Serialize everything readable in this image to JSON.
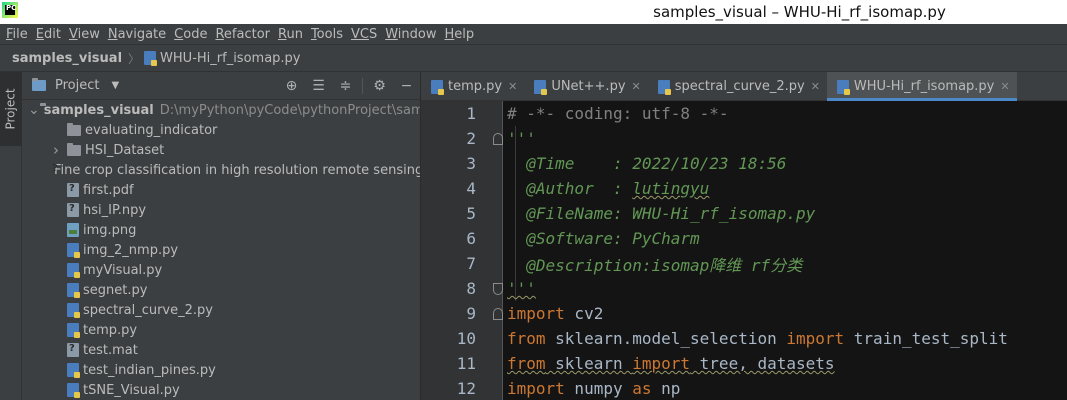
{
  "window": {
    "title": "samples_visual – WHU-Hi_rf_isomap.py",
    "logo_text": "PC"
  },
  "menu": [
    {
      "mnemonic": "F",
      "rest": "ile"
    },
    {
      "mnemonic": "E",
      "rest": "dit"
    },
    {
      "mnemonic": "V",
      "rest": "iew"
    },
    {
      "mnemonic": "N",
      "rest": "avigate"
    },
    {
      "mnemonic": "C",
      "rest": "ode"
    },
    {
      "mnemonic": "R",
      "rest": "efactor"
    },
    {
      "mnemonic": "R",
      "rest": "un"
    },
    {
      "mnemonic": "T",
      "rest": "ools"
    },
    {
      "mnemonic": "VC",
      "rest": "S"
    },
    {
      "mnemonic": "W",
      "rest": "indow"
    },
    {
      "mnemonic": "H",
      "rest": "elp"
    }
  ],
  "breadcrumb": {
    "project": "samples_visual",
    "file": "WHU-Hi_rf_isomap.py"
  },
  "left_strip": {
    "tab_label": "Project"
  },
  "project_panel": {
    "title": "Project",
    "tools": [
      "target-icon",
      "expand-all-icon",
      "collapse-all-icon",
      "gear-icon",
      "hide-icon"
    ],
    "tree": [
      {
        "label": "samples_visual",
        "path": "D:\\myPython\\pyCode\\pythonProject\\samples",
        "type": "root",
        "expanded": true
      },
      {
        "label": "evaluating_indicator",
        "type": "folder"
      },
      {
        "label": "HSI_Dataset",
        "type": "folder",
        "collapsed": true
      },
      {
        "label": "Fine crop classification in high resolution remote sensing b",
        "type": "unknown"
      },
      {
        "label": "first.pdf",
        "type": "unknown"
      },
      {
        "label": "hsi_IP.npy",
        "type": "unknown"
      },
      {
        "label": "img.png",
        "type": "image"
      },
      {
        "label": "img_2_nmp.py",
        "type": "py"
      },
      {
        "label": "myVisual.py",
        "type": "py"
      },
      {
        "label": "segnet.py",
        "type": "py"
      },
      {
        "label": "spectral_curve_2.py",
        "type": "py"
      },
      {
        "label": "temp.py",
        "type": "py"
      },
      {
        "label": "test.mat",
        "type": "unknown"
      },
      {
        "label": "test_indian_pines.py",
        "type": "py"
      },
      {
        "label": "tSNE_Visual.py",
        "type": "py"
      }
    ]
  },
  "tabs": [
    {
      "label": "temp.py",
      "active": false
    },
    {
      "label": "UNet++.py",
      "active": false
    },
    {
      "label": "spectral_curve_2.py",
      "active": false
    },
    {
      "label": "WHU-Hi_rf_isomap.py",
      "active": true
    }
  ],
  "code": {
    "line_numbers": [
      "1",
      "2",
      "3",
      "4",
      "5",
      "6",
      "7",
      "8",
      "9",
      "10",
      "11",
      "12"
    ],
    "l1": "# -*- coding: utf-8 -*-",
    "l2": "'''",
    "l3": "  @Time    : 2022/10/23 18:56",
    "l4_a": "  @Author  : ",
    "l4_b": "lutingyu",
    "l5_a": "  @FileName: ",
    "l5_b": "WHU-Hi_rf_isomap.py",
    "l6": "  @Software: PyCharm",
    "l7": "  @Description:isomap降维 rf分类",
    "l8": "'''",
    "l9_kw": "import",
    "l9_rest": " cv2",
    "l10_kw1": "from",
    "l10_mid": " sklearn.model_selection ",
    "l10_kw2": "import",
    "l10_rest": " train_test_split",
    "l11_kw1": "from",
    "l11_mid": " sklearn ",
    "l11_kw2": "import",
    "l11_rest": " tree, datasets",
    "l12_kw1": "import",
    "l12_mid": " numpy ",
    "l12_kw2": "as",
    "l12_rest": " np"
  }
}
